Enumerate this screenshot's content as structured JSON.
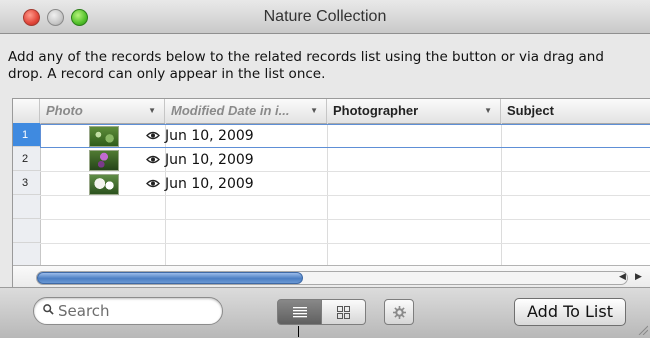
{
  "window": {
    "title": "Nature Collection"
  },
  "description": "Add any of the records below to the related records list using the button or via drag and drop.  A record can only appear in the list once.",
  "table": {
    "columns": [
      {
        "label": "Photo"
      },
      {
        "label": "Modified Date in i..."
      },
      {
        "label": "Photographer"
      },
      {
        "label": "Subject"
      }
    ],
    "rows": [
      {
        "num": "1",
        "date": "Jun 10, 2009",
        "photographer": "",
        "subject": "",
        "selected": true
      },
      {
        "num": "2",
        "date": "Jun 10, 2009",
        "photographer": "",
        "subject": "",
        "selected": false
      },
      {
        "num": "3",
        "date": "Jun 10, 2009",
        "photographer": "",
        "subject": "",
        "selected": false
      }
    ],
    "scroll_fraction": 0.45
  },
  "toolbar": {
    "search_placeholder": "Search",
    "add_button_label": "Add To List",
    "view_modes": [
      "list-view-icon",
      "grid-view-icon"
    ],
    "active_view": "list",
    "gear_icon": "gear-icon"
  },
  "colors": {
    "selection": "#3f8ae0",
    "scroll_thumb": "#4b7ec3"
  }
}
